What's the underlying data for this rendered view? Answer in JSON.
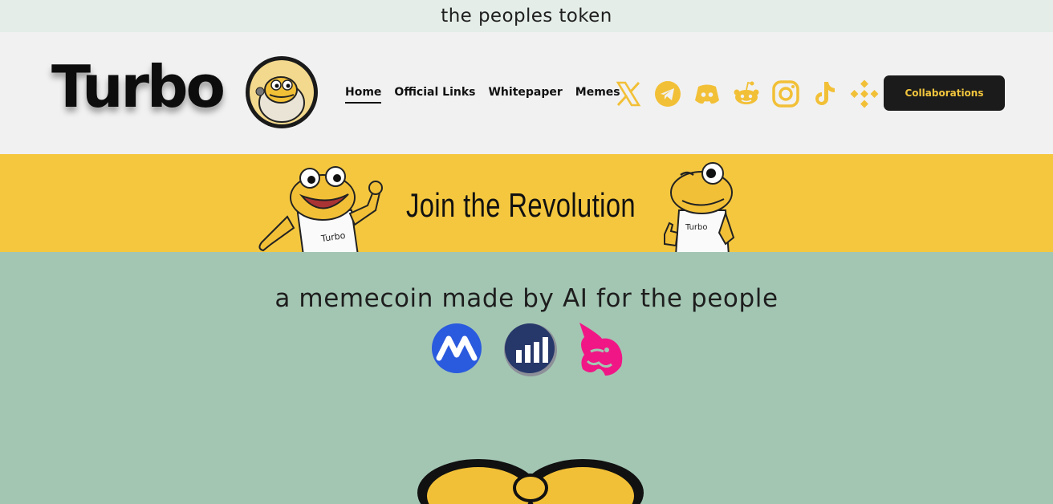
{
  "topbar": {
    "text": "the peoples token"
  },
  "header": {
    "logo_text": "Turbo",
    "nav": [
      {
        "label": "Home"
      },
      {
        "label": "Official Links"
      },
      {
        "label": "Whitepaper"
      },
      {
        "label": "Memes"
      }
    ],
    "social_icons": [
      "x-icon",
      "telegram-icon",
      "discord-icon",
      "reddit-icon",
      "instagram-icon",
      "tiktok-icon",
      "binance-icon"
    ],
    "collab_label": "Collaborations"
  },
  "banner": {
    "title": "Join the Revolution",
    "shirt_text": "Turbo"
  },
  "main": {
    "tagline": "a memecoin made by AI for the people",
    "exchange_icons": [
      "coinmarketcap-icon",
      "coingecko-icon",
      "uniswap-icon"
    ]
  },
  "colors": {
    "accent_yellow": "#f4c73f",
    "icon_yellow": "#f2c037",
    "background_green": "#a3c6b3",
    "dark": "#1b1b1b"
  }
}
